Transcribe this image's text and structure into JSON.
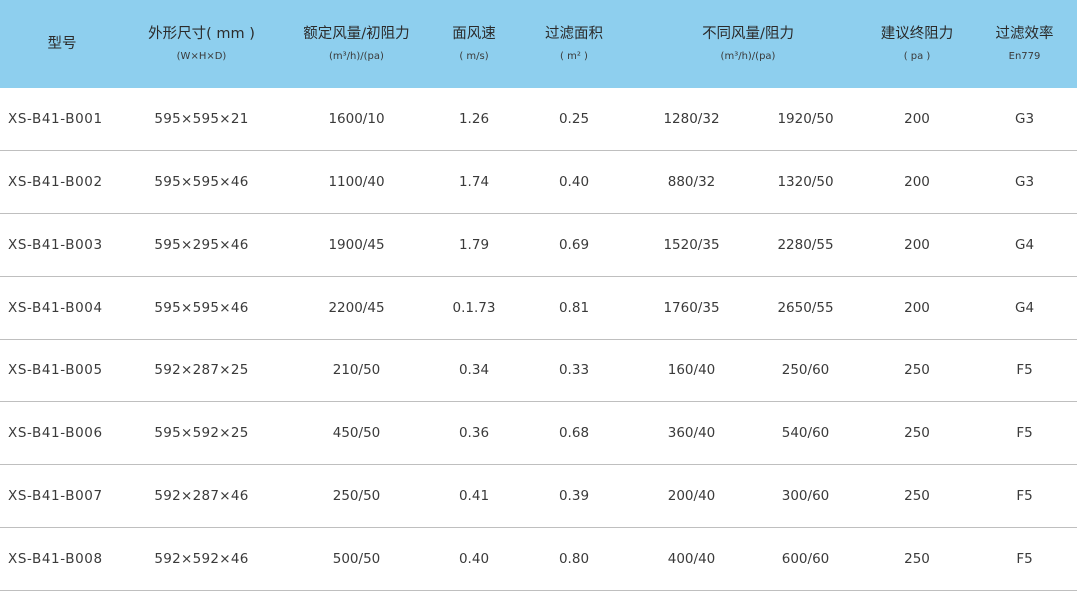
{
  "header": {
    "model": {
      "main": "型号"
    },
    "size": {
      "main": "外形尺寸( mm )",
      "sub": "(W×H×D)"
    },
    "rated": {
      "main": "额定风量/初阻力",
      "sub": "(m³/h)/(pa)"
    },
    "velocity": {
      "main": "面风速",
      "sub": "( m/s)"
    },
    "area": {
      "main": "过滤面积",
      "sub": "( m² )"
    },
    "diff": {
      "main": "不同风量/阻力",
      "sub": "(m³/h)/(pa)"
    },
    "final": {
      "main": "建议终阻力",
      "sub": "( pa )"
    },
    "efficiency": {
      "main": "过滤效率",
      "sub": "En779"
    }
  },
  "rows": [
    {
      "model": "XS-B41-B001",
      "size": "595×595×21",
      "rated": "1600/10",
      "velocity": "1.26",
      "area": "0.25",
      "diff1": "1280/32",
      "diff2": "1920/50",
      "final": "200",
      "efficiency": "G3"
    },
    {
      "model": "XS-B41-B002",
      "size": "595×595×46",
      "rated": "1100/40",
      "velocity": "1.74",
      "area": "0.40",
      "diff1": "880/32",
      "diff2": "1320/50",
      "final": "200",
      "efficiency": "G3"
    },
    {
      "model": "XS-B41-B003",
      "size": "595×295×46",
      "rated": "1900/45",
      "velocity": "1.79",
      "area": "0.69",
      "diff1": "1520/35",
      "diff2": "2280/55",
      "final": "200",
      "efficiency": "G4"
    },
    {
      "model": "XS-B41-B004",
      "size": "595×595×46",
      "rated": "2200/45",
      "velocity": "0.1.73",
      "area": "0.81",
      "diff1": "1760/35",
      "diff2": "2650/55",
      "final": "200",
      "efficiency": "G4"
    },
    {
      "model": "XS-B41-B005",
      "size": "592×287×25",
      "rated": "210/50",
      "velocity": "0.34",
      "area": "0.33",
      "diff1": "160/40",
      "diff2": "250/60",
      "final": "250",
      "efficiency": "F5"
    },
    {
      "model": "XS-B41-B006",
      "size": "595×592×25",
      "rated": "450/50",
      "velocity": "0.36",
      "area": "0.68",
      "diff1": "360/40",
      "diff2": "540/60",
      "final": "250",
      "efficiency": "F5"
    },
    {
      "model": "XS-B41-B007",
      "size": "592×287×46",
      "rated": "250/50",
      "velocity": "0.41",
      "area": "0.39",
      "diff1": "200/40",
      "diff2": "300/60",
      "final": "250",
      "efficiency": "F5"
    },
    {
      "model": "XS-B41-B008",
      "size": "592×592×46",
      "rated": "500/50",
      "velocity": "0.40",
      "area": "0.80",
      "diff1": "400/40",
      "diff2": "600/60",
      "final": "250",
      "efficiency": "F5"
    }
  ]
}
